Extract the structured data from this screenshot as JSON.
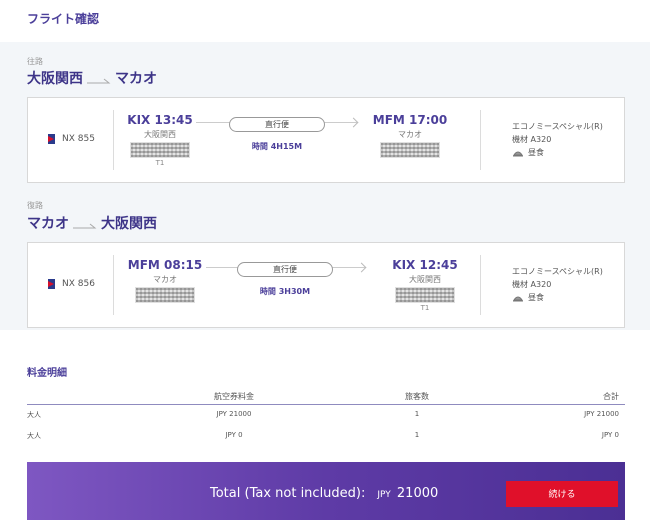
{
  "page": {
    "title": "フライト確認"
  },
  "outbound": {
    "section_label": "往路",
    "origin": "大阪関西",
    "destination": "マカオ",
    "flight_no": "NX 855",
    "dep_code_time": "KIX 13:45",
    "dep_city": "大阪関西",
    "dep_terminal": "T1",
    "arr_code_time": "MFM 17:00",
    "arr_city": "マカオ",
    "stop_label": "直行便",
    "duration": "時間 4H15M",
    "cabin": "エコノミースペシャル(R)",
    "aircraft": "機材 A320",
    "meal": "昼食"
  },
  "inbound": {
    "section_label": "復路",
    "origin": "マカオ",
    "destination": "大阪関西",
    "flight_no": "NX 856",
    "dep_code_time": "MFM 08:15",
    "dep_city": "マカオ",
    "arr_code_time": "KIX 12:45",
    "arr_city": "大阪関西",
    "arr_terminal": "T1",
    "stop_label": "直行便",
    "duration": "時間 3H30M",
    "cabin": "エコノミースペシャル(R)",
    "aircraft": "機材 A320",
    "meal": "昼食"
  },
  "fare": {
    "title": "料金明細",
    "headers": [
      "",
      "航空券料金",
      "旅客数",
      "合計"
    ],
    "rows": [
      [
        "大人",
        "JPY 21000",
        "1",
        "JPY 21000"
      ],
      [
        "大人",
        "JPY 0",
        "1",
        "JPY 0"
      ]
    ]
  },
  "total": {
    "label": "Total (Tax not included):",
    "currency": "JPY",
    "amount": "21000",
    "button_label": "続ける"
  },
  "colors": {
    "accent": "#4b3f9a",
    "button": "#e0102a",
    "bar_start": "#7e57c2",
    "bar_end": "#4b2f94"
  }
}
